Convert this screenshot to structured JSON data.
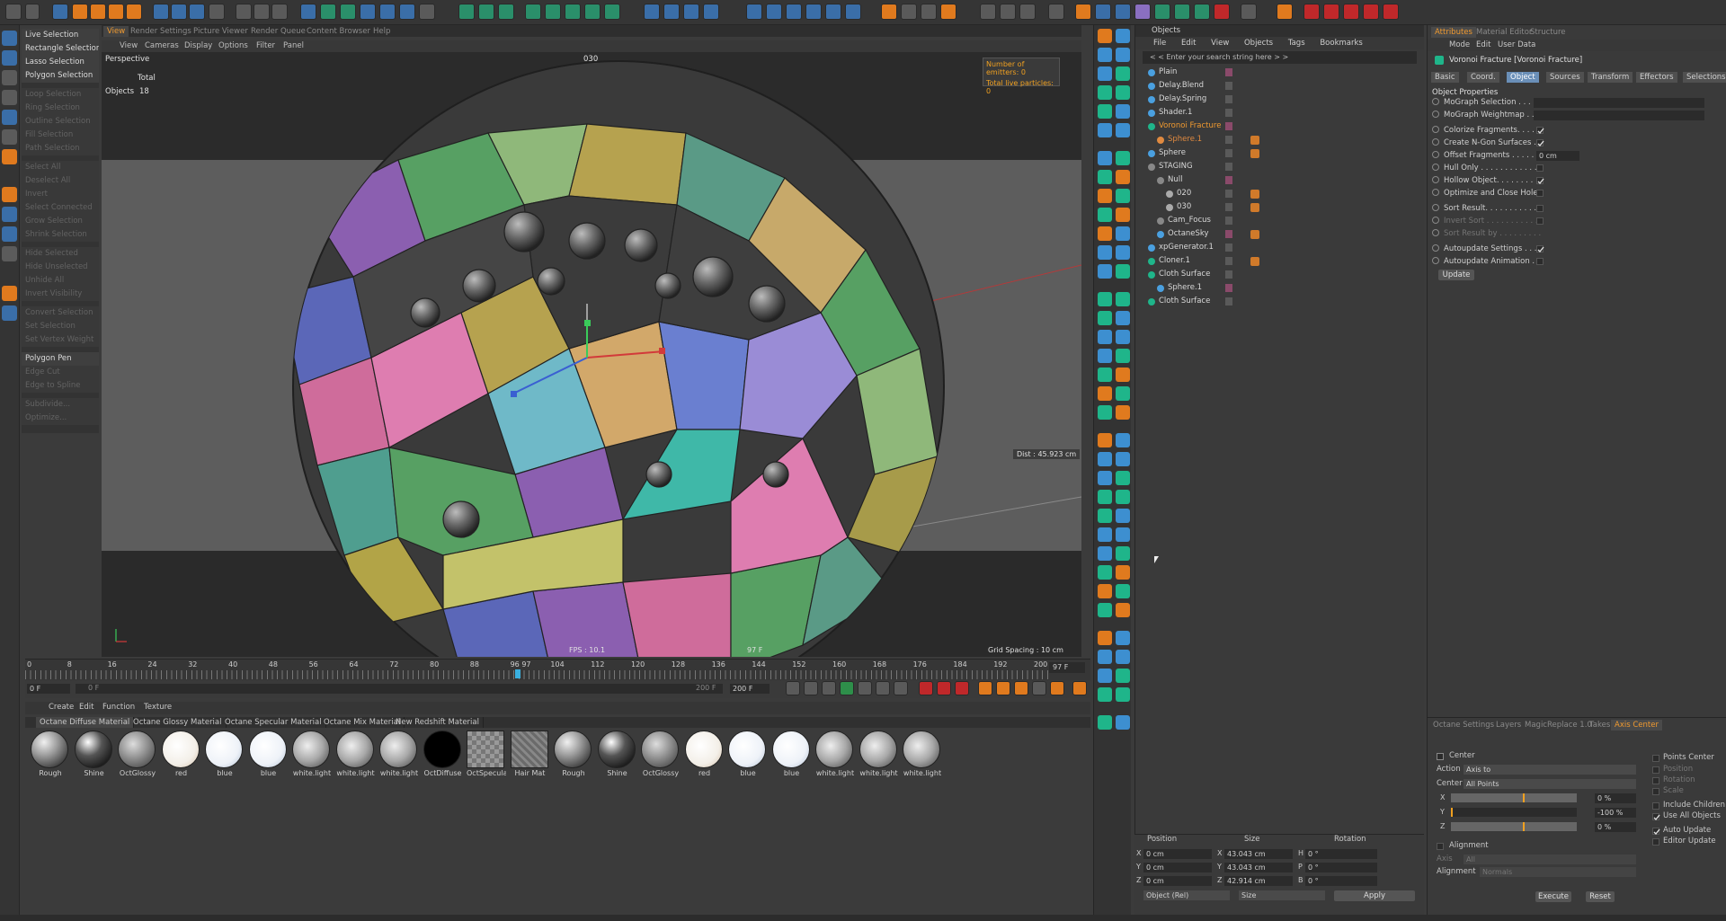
{
  "viewport": {
    "tabs": [
      "View",
      "Render Settings",
      "Picture Viewer",
      "Render Queue",
      "Content Browser",
      "Help"
    ],
    "menu": [
      "View",
      "Cameras",
      "Display",
      "Options",
      "Filter",
      "Panel"
    ],
    "label": "Perspective",
    "stats_total": "Total",
    "stats_objects_label": "Objects",
    "stats_objects_value": "18",
    "camera_name": "030",
    "emitters": "Number of emitters: 0",
    "particles": "Total live particles: 0",
    "distance": "Dist : 45.923 cm",
    "fps": "FPS : 10.1",
    "frame": "97 F",
    "grid_spacing": "Grid Spacing : 10 cm"
  },
  "selection_menu": {
    "items": [
      {
        "label": "Live Selection",
        "enabled": true
      },
      {
        "label": "Rectangle Selection",
        "enabled": true
      },
      {
        "label": "Lasso Selection",
        "enabled": true
      },
      {
        "label": "Polygon Selection",
        "enabled": true
      },
      {
        "label": "Loop Selection",
        "enabled": false
      },
      {
        "label": "Ring Selection",
        "enabled": false
      },
      {
        "label": "Outline Selection",
        "enabled": false
      },
      {
        "label": "Fill Selection",
        "enabled": false
      },
      {
        "label": "Path Selection",
        "enabled": false
      },
      {
        "label": "Select All",
        "enabled": false
      },
      {
        "label": "Deselect All",
        "enabled": false
      },
      {
        "label": "Invert",
        "enabled": false
      },
      {
        "label": "Select Connected",
        "enabled": false
      },
      {
        "label": "Grow Selection",
        "enabled": false
      },
      {
        "label": "Shrink Selection",
        "enabled": false
      },
      {
        "label": "Hide Selected",
        "enabled": false
      },
      {
        "label": "Hide Unselected",
        "enabled": false
      },
      {
        "label": "Unhide All",
        "enabled": false
      },
      {
        "label": "Invert Visibility",
        "enabled": false
      },
      {
        "label": "Convert Selection",
        "enabled": false
      },
      {
        "label": "Set Selection",
        "enabled": false
      },
      {
        "label": "Set Vertex Weight",
        "enabled": false
      },
      {
        "label": "Polygon Pen",
        "enabled": true
      },
      {
        "label": "Edge Cut",
        "enabled": false
      },
      {
        "label": "Edge to Spline",
        "enabled": false
      },
      {
        "label": "Subdivide...",
        "enabled": false
      },
      {
        "label": "Optimize...",
        "enabled": false
      }
    ]
  },
  "timeline": {
    "ticks": [
      "0",
      "8",
      "16",
      "24",
      "32",
      "40",
      "48",
      "56",
      "64",
      "72",
      "80",
      "88",
      "96 97",
      "104",
      "112",
      "120",
      "128",
      "136",
      "144",
      "152",
      "160",
      "168",
      "176",
      "184",
      "192",
      "200"
    ],
    "current_frame": "97 F",
    "start": "0 F",
    "slider_start": "0 F",
    "slider_end": "200 F",
    "end": "200 F"
  },
  "material_manager": {
    "menu": [
      "Create",
      "Edit",
      "Function",
      "Texture"
    ],
    "tabs": [
      "Octane Diffuse Material",
      "Octane Glossy Material",
      "Octane Specular Material",
      "Octane Mix Material",
      "New Redshift Material"
    ],
    "materials": [
      "Rough",
      "Shine",
      "OctGlossy",
      "red",
      "blue",
      "blue",
      "white.light",
      "white.light",
      "white.light",
      "OctDiffuse",
      "OctSpecular",
      "Hair Mat",
      "Rough",
      "Shine",
      "OctGlossy",
      "red",
      "blue",
      "blue",
      "white.light",
      "white.light",
      "white.light"
    ]
  },
  "objects_panel": {
    "title": "Objects",
    "menu": [
      "File",
      "Edit",
      "View",
      "Objects",
      "Tags",
      "Bookmarks"
    ],
    "search_placeholder": "< < Enter your search string here > >",
    "rows": [
      {
        "name": "Plain",
        "indent": 0
      },
      {
        "name": "Delay.Blend",
        "indent": 0
      },
      {
        "name": "Delay.Spring",
        "indent": 0
      },
      {
        "name": "Shader.1",
        "indent": 0
      },
      {
        "name": "Voronoi Fracture",
        "indent": 0,
        "selected": true
      },
      {
        "name": "Sphere.1",
        "indent": 1,
        "dim": true
      },
      {
        "name": "Sphere",
        "indent": 0
      },
      {
        "name": "STAGING",
        "indent": 0
      },
      {
        "name": "Null",
        "indent": 1
      },
      {
        "name": "020",
        "indent": 2
      },
      {
        "name": "030",
        "indent": 2
      },
      {
        "name": "Cam_Focus",
        "indent": 1
      },
      {
        "name": "OctaneSky",
        "indent": 1
      },
      {
        "name": "xpGenerator.1",
        "indent": 0
      },
      {
        "name": "Cloner.1",
        "indent": 0
      },
      {
        "name": "Cloth Surface",
        "indent": 0
      },
      {
        "name": "Sphere.1",
        "indent": 1
      },
      {
        "name": "Cloth Surface",
        "indent": 0
      }
    ]
  },
  "coords": {
    "headers": [
      "Position",
      "Size",
      "Rotation"
    ],
    "x": {
      "label": "X",
      "pos": "0 cm",
      "size": "43.043 cm",
      "rot_label": "H",
      "rot": "0 °"
    },
    "y": {
      "label": "Y",
      "pos": "0 cm",
      "size": "43.043 cm",
      "rot_label": "P",
      "rot": "0 °"
    },
    "z": {
      "label": "Z",
      "pos": "0 cm",
      "size": "42.914 cm",
      "rot_label": "B",
      "rot": "0 °"
    },
    "mode1": "Object (Rel)",
    "mode2": "Size",
    "apply": "Apply"
  },
  "attributes": {
    "tabs": [
      "Attributes",
      "Material Editor",
      "Structure"
    ],
    "menu": [
      "Mode",
      "Edit",
      "User Data"
    ],
    "object_title": "Voronoi Fracture [Voronoi Fracture]",
    "subtabs": [
      "Basic",
      "Coord.",
      "Object",
      "Sources",
      "Transform",
      "Effectors",
      "Selections"
    ],
    "section": "Object Properties",
    "props": [
      {
        "label": "MoGraph Selection . . . . . .",
        "type": "field"
      },
      {
        "label": "MoGraph Weightmap . . . .",
        "type": "field"
      },
      {
        "label": "Colorize Fragments. . . . . .",
        "type": "check",
        "checked": true
      },
      {
        "label": "Create N-Gon Surfaces . .",
        "type": "check",
        "checked": true
      },
      {
        "label": "Offset Fragments . . . . . . .",
        "type": "value",
        "value": "0 cm"
      },
      {
        "label": "Hull Only . . . . . . . . . . . . .",
        "type": "check",
        "checked": false
      },
      {
        "label": "Hollow Object. . . . . . . . . .",
        "type": "check",
        "checked": true
      },
      {
        "label": "Optimize and Close Holes",
        "type": "check",
        "checked": false
      },
      {
        "label": "Sort Result. . . . . . . . . . . .",
        "type": "check",
        "checked": false
      },
      {
        "label": "Invert Sort . . . . . . . . . . .",
        "type": "check",
        "checked": false,
        "disabled": true
      },
      {
        "label": "Sort Result by . . . . . . . . .",
        "type": "xyz",
        "disabled": true
      },
      {
        "label": "Autoupdate Settings . . . .",
        "type": "check",
        "checked": true
      },
      {
        "label": "Autoupdate Animation . . .",
        "type": "check",
        "checked": false
      }
    ],
    "update_button": "Update"
  },
  "axis_panel": {
    "tabs": [
      "Octane Settings",
      "Layers",
      "MagicReplace 1.0",
      "Takes",
      "Axis Center"
    ],
    "center_label": "Center",
    "action_label": "Action",
    "action_value": "Axis to",
    "center_field_label": "Center",
    "center_value": "All Points",
    "x_label": "X",
    "x_value": "0 %",
    "y_label": "Y",
    "y_value": "-100 %",
    "z_label": "Z",
    "z_value": "0 %",
    "alignment_label": "Alignment",
    "axis_label": "Axis",
    "axis_value": "All",
    "alignment_field_label": "Alignment",
    "alignment_value": "Normals",
    "right_options": [
      "Points Center",
      "Position",
      "Rotation",
      "Scale",
      "Include Children",
      "Use All Objects",
      "Auto Update",
      "Editor Update"
    ],
    "execute": "Execute",
    "reset": "Reset"
  }
}
